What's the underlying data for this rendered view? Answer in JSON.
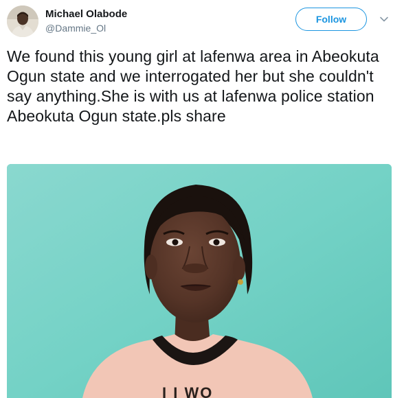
{
  "author": {
    "display_name": "Michael Olabode",
    "handle": "@Dammie_Ol"
  },
  "actions": {
    "follow_label": "Follow",
    "menu_icon": "chevron-down-icon"
  },
  "tweet": {
    "text": "We found this young girl at lafenwa area in Abeokuta Ogun state and we interrogated her but she couldn't say anything.She is with us at lafenwa police station Abeokuta Ogun state.pls share"
  },
  "media": {
    "shirt_text": "I I WO"
  },
  "colors": {
    "accent": "#1b95e0",
    "text": "#14171a",
    "secondary_text": "#657786",
    "photo_background": "#6fd0c4"
  }
}
